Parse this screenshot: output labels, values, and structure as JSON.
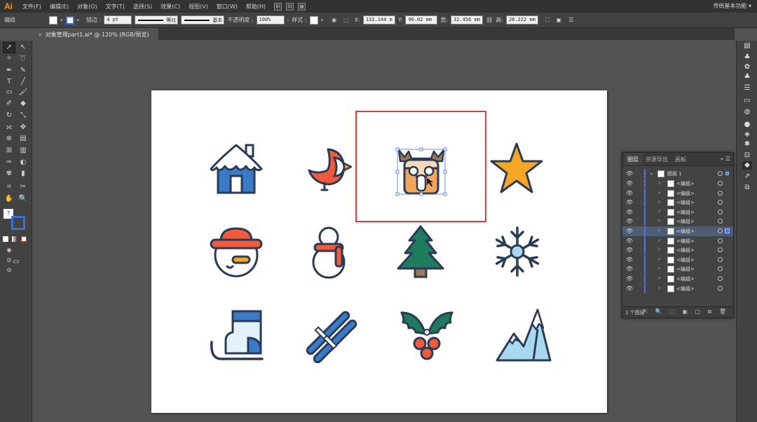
{
  "app": {
    "logo": "Ai",
    "workspace": "传统基本功能 ▾"
  },
  "menu": [
    "文件(F)",
    "编辑(E)",
    "对象(O)",
    "文字(T)",
    "选择(S)",
    "效果(C)",
    "视图(V)",
    "窗口(W)",
    "帮助(H)"
  ],
  "menu_icons": [
    "Br",
    "St"
  ],
  "controlbar": {
    "group_label": "编组",
    "stroke_label": "描边 :",
    "stroke_value": "4 pt",
    "profile_label": "等比",
    "brush_label": "基本",
    "opacity_label": "不透明度 :",
    "opacity_value": "100%",
    "style_label": "样式 :",
    "x_label": "X:",
    "x_value": "132.144 m",
    "y_label": "Y:",
    "y_value": "96.02 mm",
    "w_label": "宽:",
    "w_value": "32.456 mm",
    "h_label": "高:",
    "h_value": "28.222 mm"
  },
  "document": {
    "tab_title": "对象管理part1.ai* @ 120% (RGB/预览)"
  },
  "layers_panel": {
    "tabs": [
      "图层",
      "资源导出",
      "画板"
    ],
    "menu_glyph": "☰",
    "collapse_glyph": "»",
    "layer_name": "图层 1",
    "items": [
      {
        "name": "<编组>",
        "selected": false
      },
      {
        "name": "<编组>",
        "selected": false
      },
      {
        "name": "<编组>",
        "selected": false
      },
      {
        "name": "<编组>",
        "selected": false
      },
      {
        "name": "<编组>",
        "selected": false
      },
      {
        "name": "<编组>",
        "selected": true
      },
      {
        "name": "<编组>",
        "selected": false
      },
      {
        "name": "<编组>",
        "selected": false
      },
      {
        "name": "<编组>",
        "selected": false
      },
      {
        "name": "<编组>",
        "selected": false
      },
      {
        "name": "<编组>",
        "selected": false
      },
      {
        "name": "<编组>",
        "selected": false
      }
    ],
    "footer_count": "1 个图层"
  },
  "colors": {
    "blue": "#3a7bc8",
    "dark": "#2b3a55",
    "red": "#f15a3b",
    "orange": "#f5a623",
    "green": "#1e7b5e",
    "lightblue": "#a8d8f0",
    "highlight": "#e63a3a"
  }
}
